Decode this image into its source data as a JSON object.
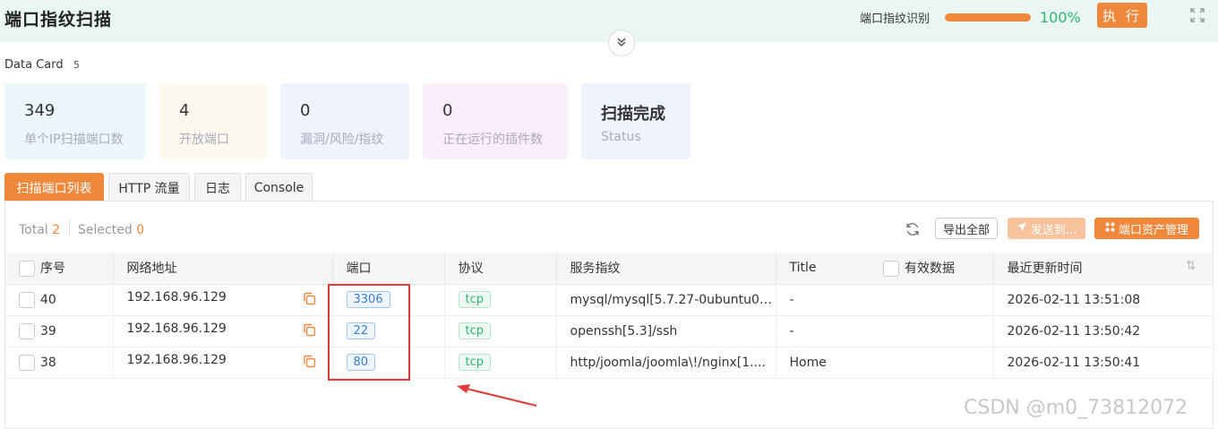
{
  "header": {
    "title": "端口指纹扫描",
    "progress_label": "端口指纹识别",
    "progress_value": 100,
    "progress_text": "100%",
    "execute_label": "执 行"
  },
  "data_card": {
    "label": "Data Card",
    "count": "5",
    "cards": [
      {
        "value": "349",
        "label": "单个IP扫描端口数",
        "color": "#ecf7fb"
      },
      {
        "value": "4",
        "label": "开放端口",
        "color": "#fdf9ef"
      },
      {
        "value": "0",
        "label": "漏洞/风险/指纹",
        "color": "#eef3fc"
      },
      {
        "value": "0",
        "label": "正在运行的插件数",
        "color": "#f9eefa"
      },
      {
        "value": "扫描完成",
        "label": "Status",
        "color": "#eef3fc"
      }
    ]
  },
  "tabs": [
    "扫描端口列表",
    "HTTP 流量",
    "日志",
    "Console"
  ],
  "toolbar": {
    "total_label": "Total",
    "total_value": "2",
    "selected_label": "Selected",
    "selected_value": "0",
    "export_label": "导出全部",
    "send_label": "发送到...",
    "asset_label": "端口资产管理"
  },
  "table": {
    "columns": [
      "序号",
      "网络地址",
      "端口",
      "协议",
      "服务指纹",
      "Title",
      "有效数据",
      "最近更新时间"
    ],
    "rows": [
      {
        "id": "40",
        "address": "192.168.96.129",
        "port": "3306",
        "protocol": "tcp",
        "fingerprint": "mysql/mysql[5.7.27-0ubuntu0....",
        "title": "-",
        "updated": "2026-02-11 13:51:08"
      },
      {
        "id": "39",
        "address": "192.168.96.129",
        "port": "22",
        "protocol": "tcp",
        "fingerprint": "openssh[5.3]/ssh",
        "title": "-",
        "updated": "2026-02-11 13:50:42"
      },
      {
        "id": "38",
        "address": "192.168.96.129",
        "port": "80",
        "protocol": "tcp",
        "fingerprint": "http/joomla/joomla\\!/nginx[1....",
        "title": "Home",
        "updated": "2026-02-11 13:50:41"
      }
    ]
  },
  "watermark": "CSDN @m0_73812072",
  "colors": {
    "accent": "#f0883c",
    "success": "#2bb673",
    "annotation": "#e03a3a"
  }
}
